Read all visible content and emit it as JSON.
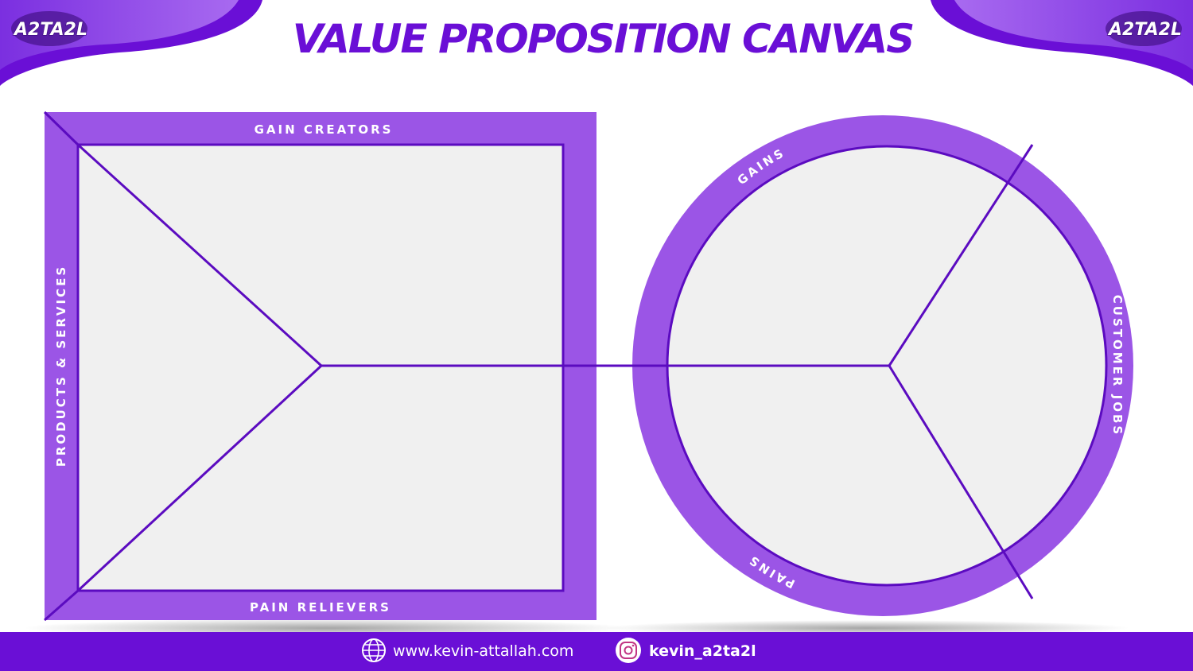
{
  "title": "VALUE PROPOSITION CANVAS",
  "logo": {
    "text": "A2TA2L"
  },
  "value_map": {
    "top_label": "GAIN CREATORS",
    "bottom_label": "PAIN RELIEVERS",
    "left_label": "PRODUCTS & SERVICES"
  },
  "customer_profile": {
    "gains_label": "GAINS",
    "pains_label": "PAINS",
    "jobs_label": "CUSTOMER JOBS"
  },
  "footer": {
    "website": "www.kevin-attallah.com",
    "instagram": "kevin_a2ta2l"
  },
  "colors": {
    "purple": "#6a0fd6",
    "light_purple": "#9b55e6",
    "panel": "#f0f0f0",
    "line": "#5b0bc0"
  }
}
